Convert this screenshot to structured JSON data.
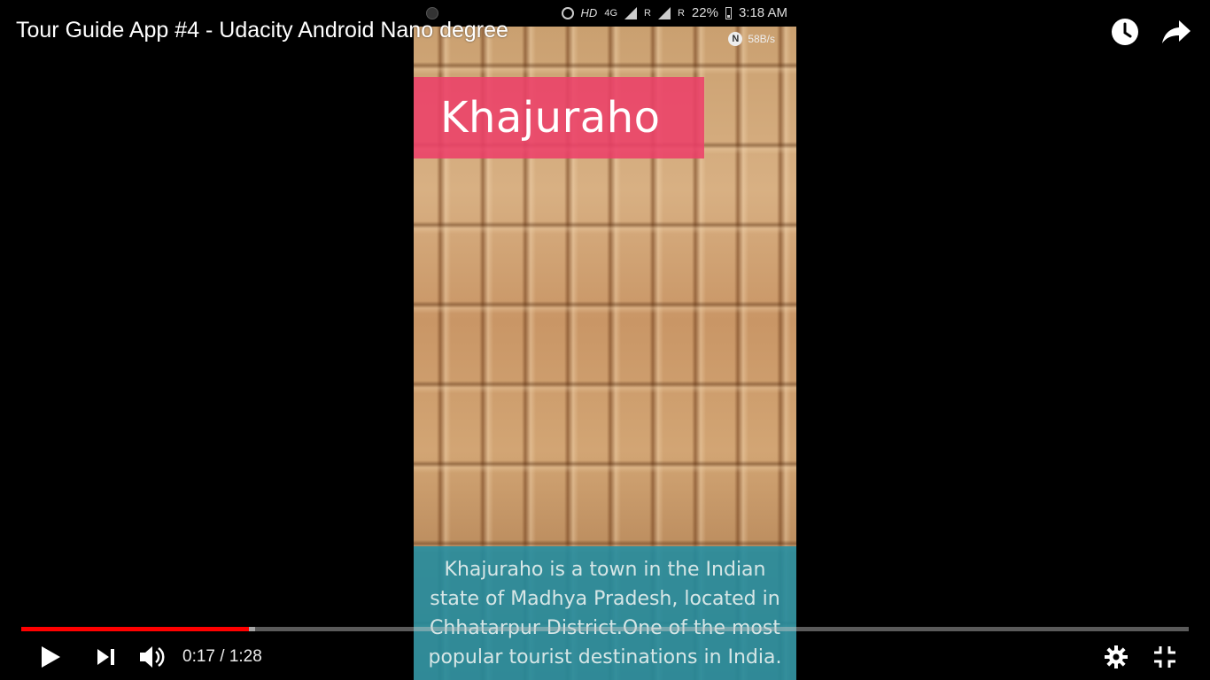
{
  "video": {
    "title": "Tour Guide App #4 - Udacity Android Nano degree",
    "current_time": "0:17",
    "separator": " / ",
    "duration": "1:28",
    "progress_fraction": 0.195,
    "buffered_fraction": 0.2
  },
  "phone": {
    "status": {
      "hd": "HD",
      "network": "4G",
      "roaming_1": "R",
      "roaming_2": "R",
      "battery": "22%",
      "clock": "3:18 AM",
      "speed_badge_letter": "N",
      "speed": "58B/s"
    },
    "app": {
      "title": "Khajuraho",
      "description": "Khajuraho is a town in the Indian state of Madhya Pradesh, located in Chhatarpur District.One of the most popular tourist destinations in India."
    }
  },
  "icons": {
    "watch_later": "clock-icon",
    "share": "share-arrow-icon",
    "play": "play-icon",
    "next": "next-icon",
    "volume": "volume-icon",
    "settings": "gear-icon",
    "exit_fullscreen": "exit-fullscreen-icon"
  },
  "colors": {
    "progress_played": "#ff0000",
    "title_banner": "#ec4069",
    "description_panel": "#208ca0"
  }
}
